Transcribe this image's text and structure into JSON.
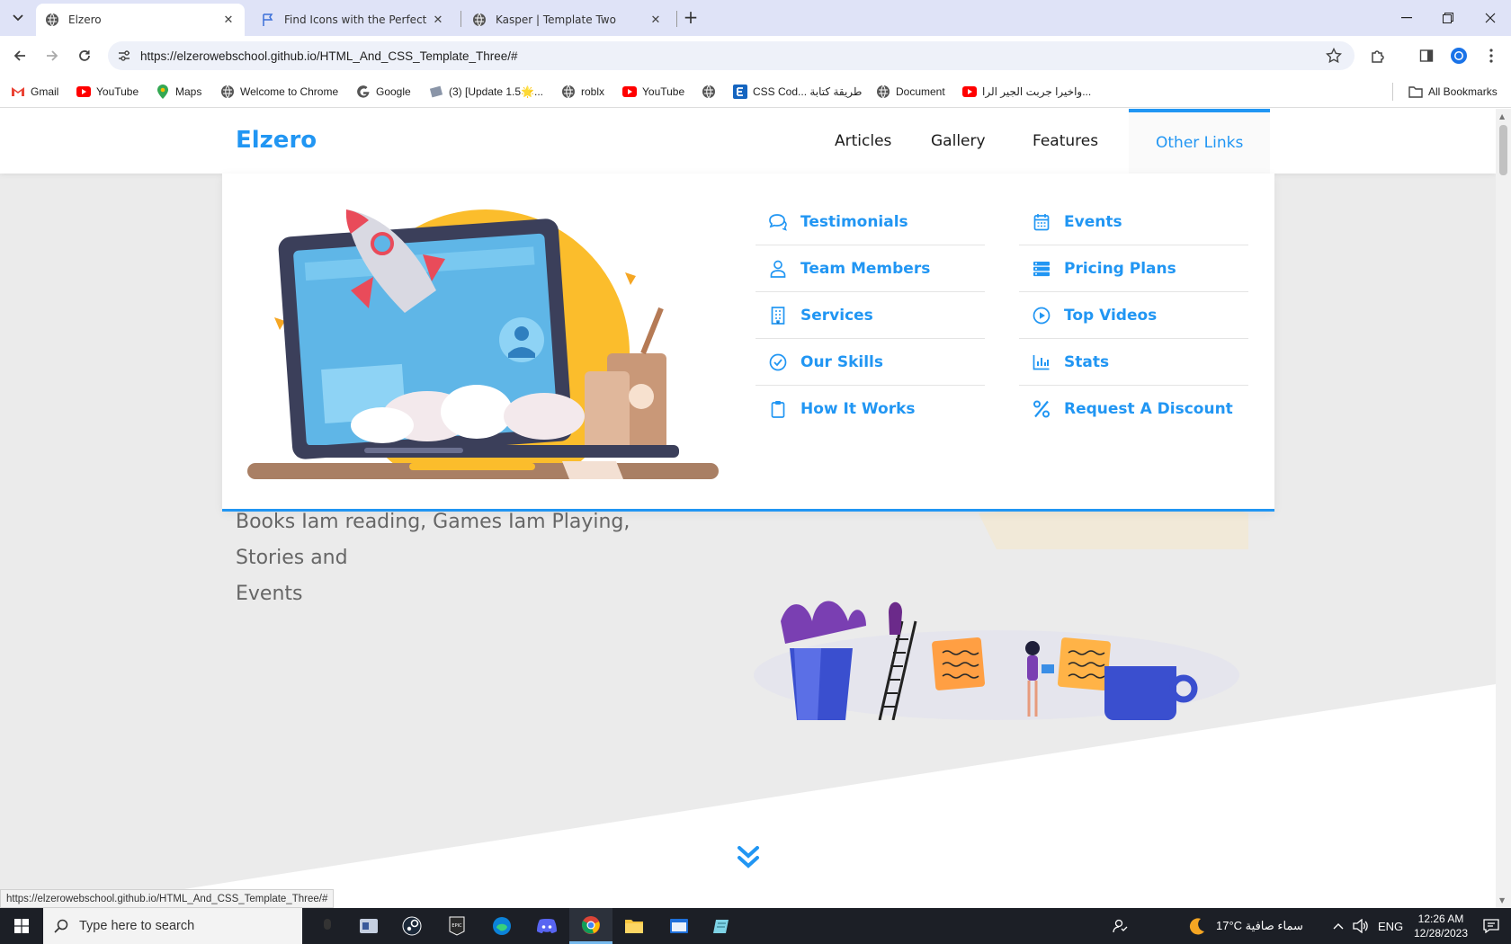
{
  "browser": {
    "tabs": [
      {
        "title": "Elzero",
        "active": true
      },
      {
        "title": "Find Icons with the Perfect Look",
        "active": false
      },
      {
        "title": "Kasper | Template Two",
        "active": false
      }
    ],
    "new_tab": "+",
    "url": "https://elzerowebschool.github.io/HTML_And_CSS_Template_Three/#",
    "bookmarks": [
      {
        "label": "Gmail",
        "icon": "gmail-icon"
      },
      {
        "label": "YouTube",
        "icon": "youtube-icon"
      },
      {
        "label": "Maps",
        "icon": "maps-icon"
      },
      {
        "label": "Welcome to Chrome",
        "icon": "globe-icon"
      },
      {
        "label": "Google",
        "icon": "google-icon"
      },
      {
        "label": "(3) [Update 1.5🌟...",
        "icon": "roblox-game-icon"
      },
      {
        "label": "roblx",
        "icon": "globe-icon"
      },
      {
        "label": "YouTube",
        "icon": "youtube-icon"
      },
      {
        "label": "",
        "icon": "globe-icon"
      },
      {
        "label": "CSS Cod... طريقة كتابة",
        "icon": "e-icon"
      },
      {
        "label": "Document",
        "icon": "globe-icon"
      },
      {
        "label": "واخيرا جربت الجير الرا...",
        "icon": "youtube-icon"
      }
    ],
    "all_bookmarks": "All Bookmarks",
    "status_url": "https://elzerowebschool.github.io/HTML_And_CSS_Template_Three/#"
  },
  "site": {
    "logo": "Elzero",
    "nav": [
      "Articles",
      "Gallery",
      "Features",
      "Other Links"
    ],
    "mega_left": [
      {
        "label": "Testimonials",
        "icon": "comments-icon"
      },
      {
        "label": "Team Members",
        "icon": "user-icon"
      },
      {
        "label": "Services",
        "icon": "building-icon"
      },
      {
        "label": "Our Skills",
        "icon": "check-circle-icon"
      },
      {
        "label": "How It Works",
        "icon": "clipboard-icon"
      }
    ],
    "mega_right": [
      {
        "label": "Events",
        "icon": "calendar-icon"
      },
      {
        "label": "Pricing Plans",
        "icon": "server-icon"
      },
      {
        "label": "Top Videos",
        "icon": "play-circle-icon"
      },
      {
        "label": "Stats",
        "icon": "chart-icon"
      },
      {
        "label": "Request A Discount",
        "icon": "percent-icon"
      }
    ],
    "hero_text_line1": "Books Iam reading, Games Iam Playing, Stories and",
    "hero_text_line2": "Events"
  },
  "taskbar": {
    "search_placeholder": "Type here to search",
    "weather": "17°C  سماء صافية",
    "lang": "ENG",
    "time": "12:26 AM",
    "date": "12/28/2023"
  },
  "colors": {
    "accent": "#2196f3",
    "tabstrip": "#dfe3f7",
    "taskbar": "#1c1f26"
  }
}
